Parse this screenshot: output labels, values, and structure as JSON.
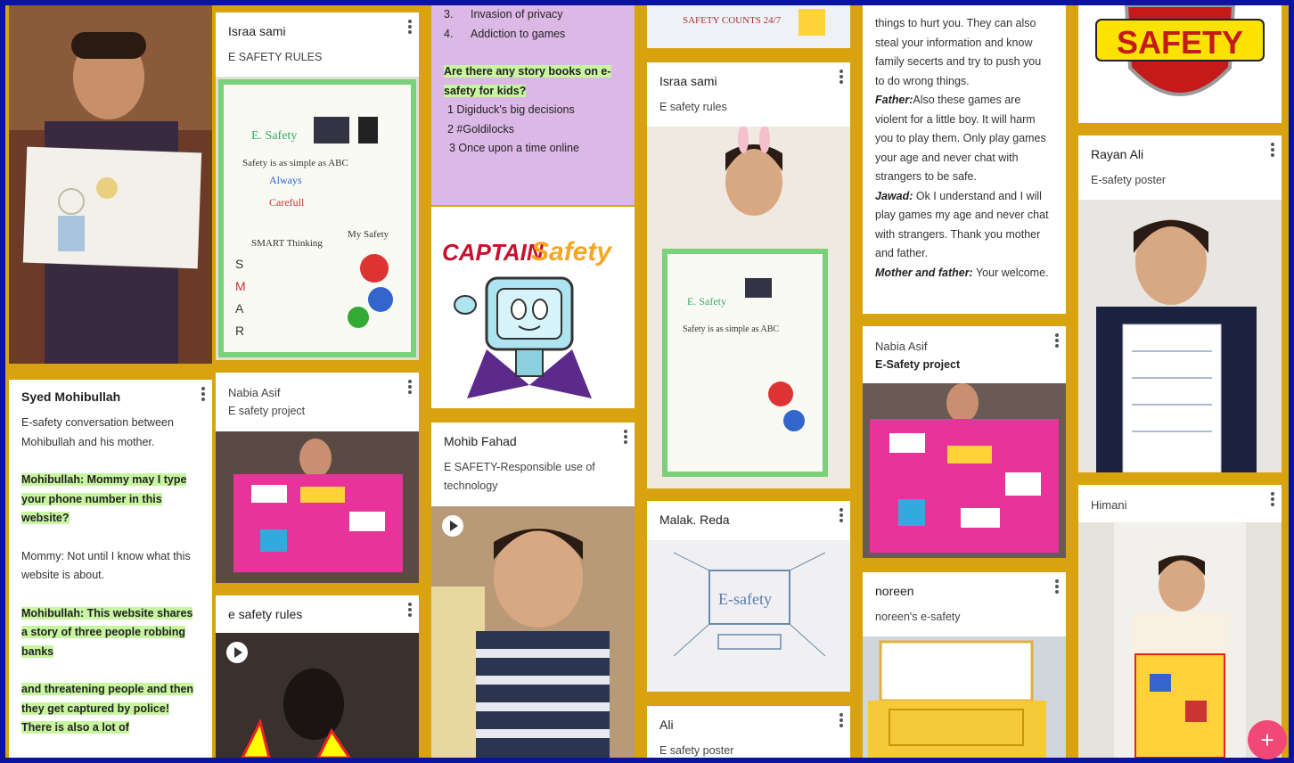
{
  "cards": {
    "c1": {
      "title": "Syed Mohibullah",
      "sub": "E-safety conversation between Mohibullah and his mother.",
      "p1": "Mohibullah: Mommy may I type your phone number in this website?",
      "p2": "Mommy: Not until I know what this website is about.",
      "p3": "Mohibullah: This website shares a story of three people robbing banks",
      "p4": "and threatening people and then they get captured by police! There is also a lot of"
    },
    "c2": {
      "title": "Israa sami",
      "sub": "E SAFETY RULES"
    },
    "c3": {
      "title": "Nabia Asif",
      "sub": "E safety  project"
    },
    "c4": {
      "title": "e safety rules"
    },
    "c5": {
      "li3num": "3.",
      "li3": "Invasion of privacy",
      "li4num": "4.",
      "li4": "Addiction to games",
      "q": "Are there any story books on e-safety for kids?",
      "b1": "1 Digiduck's big decisions",
      "b2": "2 #Goldilocks",
      "b3": "3   Once upon a time online",
      "logo_word1": "CAPTAIN",
      "logo_word2": "Safety"
    },
    "c6": {
      "title": "Mohib Fahad",
      "sub": "E SAFETY-Responsible use of technology"
    },
    "c7": {
      "top_text": "SAFETY COUNTS 24/7"
    },
    "c8": {
      "title": "Israa sami",
      "sub": "E safety rules"
    },
    "c9": {
      "title": "Malak. Reda",
      "drawing": "E-safety"
    },
    "c10": {
      "title": "Ali",
      "sub": "E safety poster"
    },
    "c11": {
      "l1": "things to hurt you. They can also steal your information and know family secerts and try to push you to do wrong things.",
      "l2a": "Father:",
      "l2b": "Also these games are violent for a little boy. It will harm you to play them. Only play games your age and never chat with strangers to be safe.",
      "l3a": "Jawad:",
      "l3b": " Ok I understand and I will play games my age and never chat with strangers. Thank you mother and father.",
      "l4a": "Mother and father:",
      "l4b": " Your welcome."
    },
    "c12": {
      "title": "Nabia Asif",
      "sub": "E-Safety project"
    },
    "c13": {
      "title": "noreen",
      "sub": "noreen's e-safety"
    },
    "c14": {
      "badge": "SAFETY"
    },
    "c15": {
      "title": "Rayan Ali",
      "sub": "E-safety poster"
    },
    "c16": {
      "title": "Himani"
    }
  },
  "fab_label": "+",
  "colors": {
    "board": "#d9a20f",
    "frame": "#0a14a0",
    "highlight": "#c8f5a0",
    "fab": "#f24878",
    "purple_card": "#dcb8e6"
  }
}
